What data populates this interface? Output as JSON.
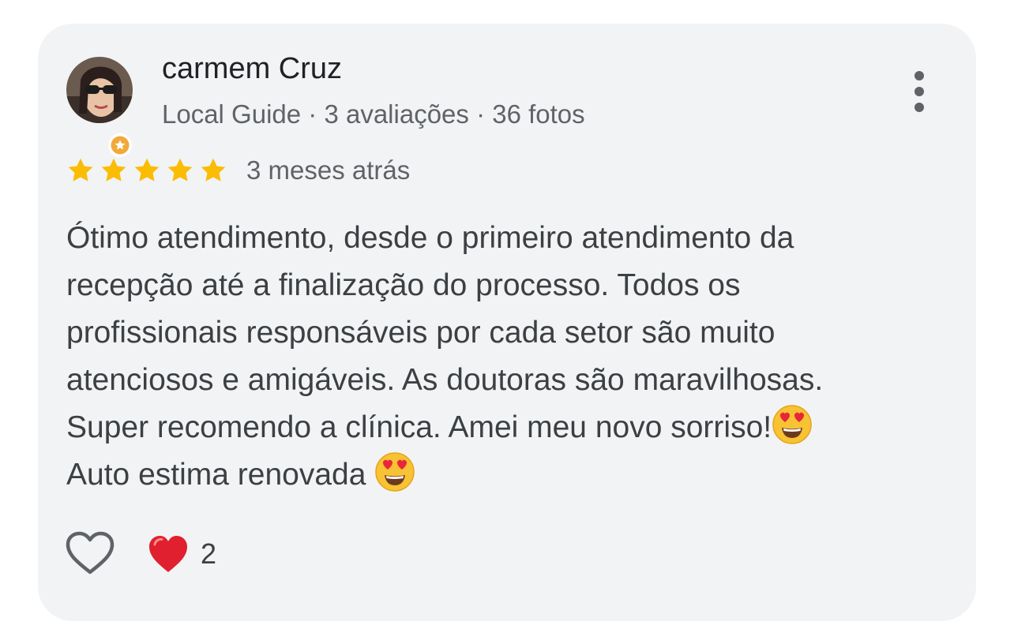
{
  "reviewer": {
    "name": "carmem Cruz",
    "meta": "Local Guide · 3 avaliações · 36 fotos"
  },
  "review": {
    "rating": 5,
    "rating_max": 5,
    "date": "3 meses atrás",
    "lines": [
      "Ótimo atendimento, desde o primeiro atendimento da",
      "recepção até a finalização do processo. Todos os",
      "profissionais responsáveis por cada setor são muito",
      "atenciosos e amigáveis. As doutoras são maravilhosas.",
      "Super recomendo a clínica. Amei meu novo sorriso!",
      "Auto estima renovada "
    ],
    "emoji": "heart-eyes-emoji"
  },
  "reactions": {
    "like_icon": "heart-outline-icon",
    "reaction_icon": "red-heart-icon",
    "count": "2"
  },
  "colors": {
    "card_background": "#f2f3f5",
    "star": "#fbbc04",
    "name": "#202124",
    "secondary_text": "#5f6368",
    "body_text": "#3c4043",
    "heart_red": "#e0202e"
  }
}
